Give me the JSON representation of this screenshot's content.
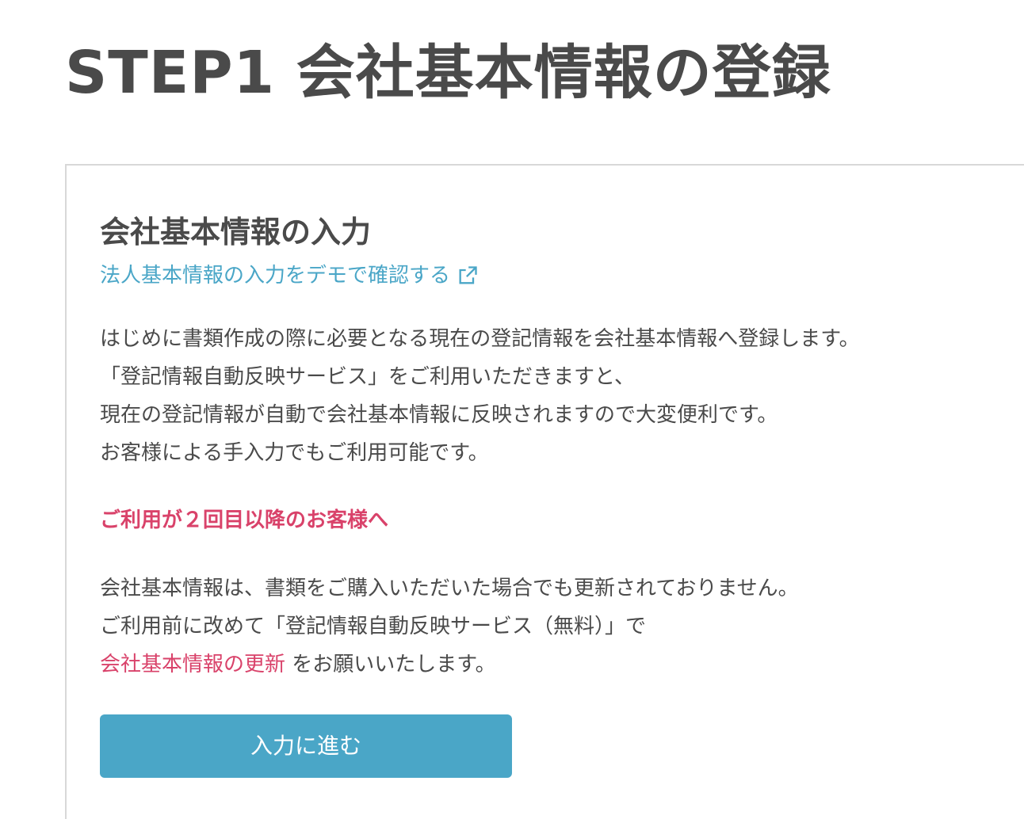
{
  "page": {
    "title": "STEP1 会社基本情報の登録"
  },
  "section": {
    "title": "会社基本情報の入力",
    "demo_link_label": "法人基本情報の入力をデモで確認する",
    "demo_link_icon": "external-link-icon",
    "intro_lines": [
      "はじめに書類作成の際に必要となる現在の登記情報を会社基本情報へ登録します。",
      "「登記情報自動反映サービス」をご利用いただきますと、",
      "現在の登記情報が自動で会社基本情報に反映されますので大変便利です。",
      "お客様による手入力でもご利用可能です。"
    ],
    "notice_heading": "ご利用が２回目以降のお客様へ",
    "notice_line_1": "会社基本情報は、書類をご購入いただいた場合でも更新されておりません。",
    "notice_line_2": " ご利用前に改めて「登記情報自動反映サービス（無料）」で",
    "update_link_label": "会社基本情報の更新",
    "notice_line_3_suffix": " をお願いいたします。",
    "proceed_button_label": "入力に進む"
  },
  "colors": {
    "text": "#4a4a4a",
    "link_blue": "#4aa6c7",
    "accent_pink": "#d9426a",
    "button_bg": "#4aa6c7",
    "border": "#d8d8d8"
  }
}
